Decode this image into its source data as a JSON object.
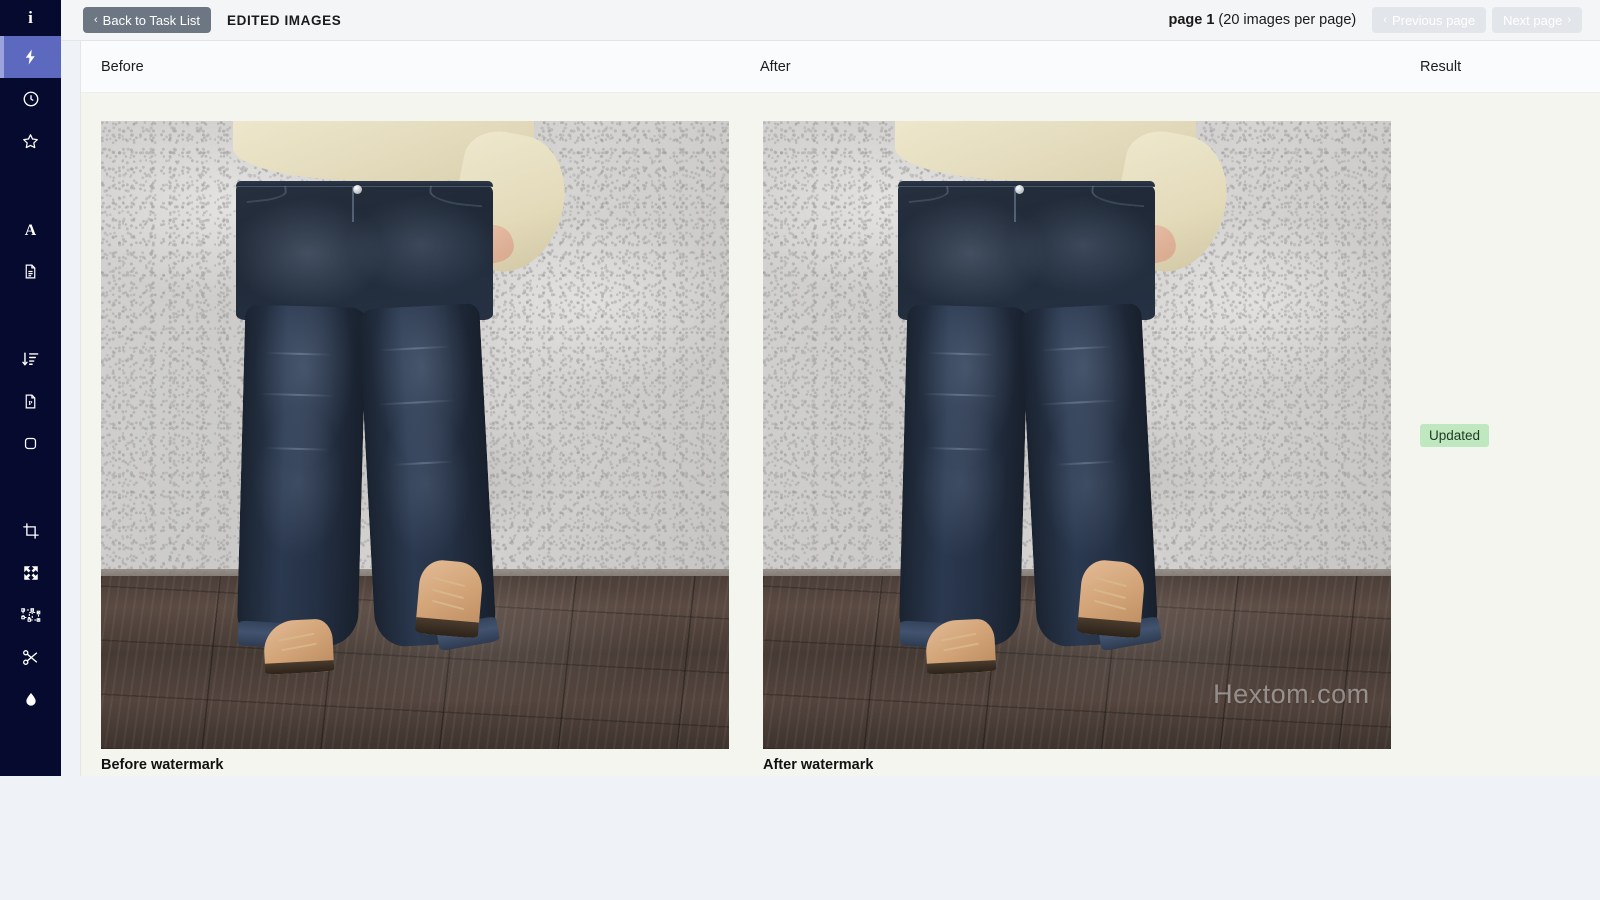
{
  "sidebar": {
    "logo": "i",
    "items": [
      {
        "icon": "lightning-bolt-icon",
        "name": "bulk-edit",
        "active": true
      },
      {
        "icon": "clock-icon",
        "name": "scheduled",
        "active": false
      },
      {
        "icon": "star-icon",
        "name": "favorites",
        "active": false
      },
      {
        "icon": "letter-a-icon",
        "name": "alt-text",
        "active": false
      },
      {
        "icon": "document-icon",
        "name": "file-name",
        "active": false
      },
      {
        "icon": "sort-amount-down-icon",
        "name": "reorder",
        "active": false
      },
      {
        "icon": "file-pdf-icon",
        "name": "image-format",
        "active": false
      },
      {
        "icon": "rounded-square-icon",
        "name": "backdrop",
        "active": false
      },
      {
        "icon": "crop-icon",
        "name": "crop",
        "active": false
      },
      {
        "icon": "expand-arrows-icon",
        "name": "resize",
        "active": false
      },
      {
        "icon": "object-group-icon",
        "name": "canvas",
        "active": false
      },
      {
        "icon": "scissors-icon",
        "name": "remove-background",
        "active": false
      },
      {
        "icon": "water-drop-icon",
        "name": "watermark",
        "active": false
      }
    ]
  },
  "topbar": {
    "back_label": "Back to Task List",
    "back_chevron": "‹",
    "title": "EDITED IMAGES",
    "page_label_bold": "page 1",
    "page_label_rest": " (20 images per page)",
    "previous_label": "Previous page",
    "previous_chevron": "‹",
    "next_label": "Next page",
    "next_chevron": "›"
  },
  "table": {
    "columns": {
      "before": "Before",
      "after": "After",
      "result": "Result"
    },
    "row": {
      "before_caption": "Before watermark",
      "after_caption": "After watermark",
      "result_badge": "Updated",
      "after_image_watermark": "Hextom.com"
    }
  },
  "colors": {
    "sidebar_bg": "#060a2e",
    "sidebar_active": "#5c69bf",
    "topbar_bg": "#f4f5f7",
    "back_button": "#6d7683",
    "page_button_disabled": "#e2e5ea",
    "content_bg": "#f5f5f0",
    "page_bg": "#eff3f7",
    "badge_bg": "#bfe8c0",
    "badge_text": "#1d3a1f"
  }
}
